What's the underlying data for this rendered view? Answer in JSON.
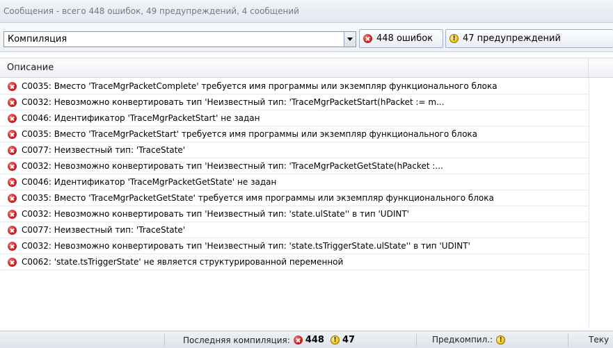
{
  "title": "Сообщения - всего 448 ошибок, 49 предупреждений, 4 сообщений",
  "toolbar": {
    "category": "Компиляция",
    "errors_label": "448 ошибок",
    "warnings_label": "47 предупреждений"
  },
  "columns": {
    "description": "Описание"
  },
  "messages": [
    {
      "type": "error",
      "text": "C0035:  Вместо 'TraceMgrPacketComplete' требуется имя программы или экземпляр функционального блока"
    },
    {
      "type": "error",
      "text": "C0032:  Невозможно конвертировать тип 'Неизвестный тип: 'TraceMgrPacketStart(hPacket := m..."
    },
    {
      "type": "error",
      "text": "C0046: Идентификатор 'TraceMgrPacketStart' не задан"
    },
    {
      "type": "error",
      "text": "C0035:  Вместо 'TraceMgrPacketStart' требуется имя программы или экземпляр функционального блока"
    },
    {
      "type": "error",
      "text": "C0077: Неизвестный тип: 'TraceState'"
    },
    {
      "type": "error",
      "text": "C0032:  Невозможно конвертировать тип 'Неизвестный тип: 'TraceMgrPacketGetState(hPacket :..."
    },
    {
      "type": "error",
      "text": "C0046: Идентификатор 'TraceMgrPacketGetState' не задан"
    },
    {
      "type": "error",
      "text": "C0035:  Вместо 'TraceMgrPacketGetState' требуется имя программы или экземпляр функционального блока"
    },
    {
      "type": "error",
      "text": "C0032:  Невозможно конвертировать тип 'Неизвестный тип: 'state.ulState'' в тип 'UDINT'"
    },
    {
      "type": "error",
      "text": "C0077: Неизвестный тип: 'TraceState'"
    },
    {
      "type": "error",
      "text": "C0032:  Невозможно конвертировать тип 'Неизвестный тип: 'state.tsTriggerState.ulState'' в тип 'UDINT'"
    },
    {
      "type": "error",
      "text": "C0062:  'state.tsTriggerState' не является структурированной переменной"
    }
  ],
  "status": {
    "last_compile_label": "Последняя компиляция:",
    "error_count": "448",
    "warning_count": "47",
    "precompile_label": "Предкомпил.:",
    "right_label": "Теку"
  }
}
